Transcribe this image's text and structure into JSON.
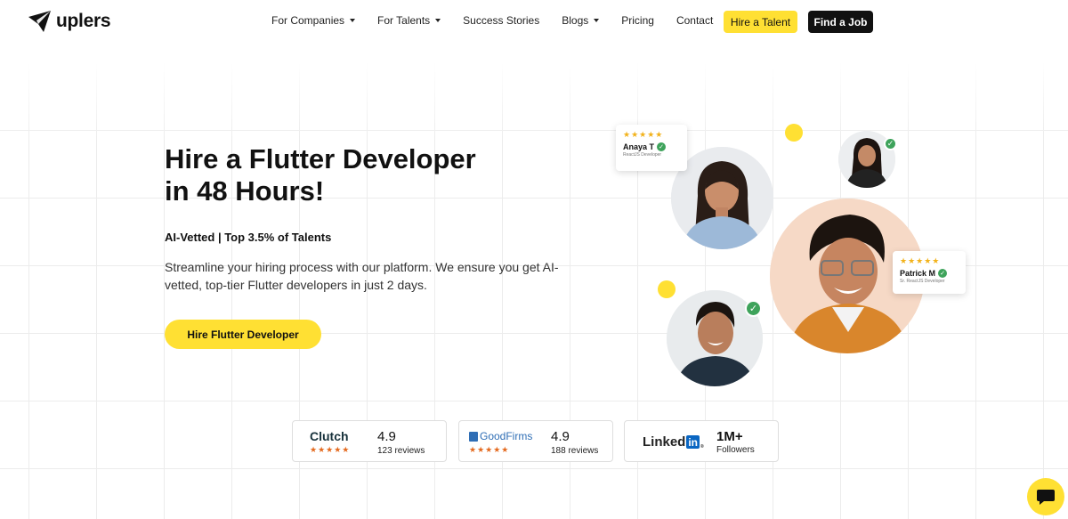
{
  "brand": {
    "name": "uplers"
  },
  "nav": {
    "items": [
      {
        "label": "For Companies",
        "has_dropdown": true
      },
      {
        "label": "For Talents",
        "has_dropdown": true
      },
      {
        "label": "Success Stories",
        "has_dropdown": false
      },
      {
        "label": "Blogs",
        "has_dropdown": true
      },
      {
        "label": "Pricing",
        "has_dropdown": false
      },
      {
        "label": "Contact",
        "has_dropdown": false
      }
    ],
    "hire_talent_label": "Hire a Talent",
    "find_job_label": "Find a Job"
  },
  "hero": {
    "title_line1": "Hire a Flutter Developer",
    "title_line2": "in 48 Hours!",
    "tagline": "AI-Vetted | Top 3.5% of Talents",
    "description": "Streamline your hiring process with our platform. We ensure you get AI-vetted, top-tier Flutter developers in just 2 days.",
    "cta_label": "Hire Flutter Developer"
  },
  "profiles": {
    "anaya": {
      "stars": "★★★★★",
      "name": "Anaya T",
      "role": "ReactJS Developer"
    },
    "patrick": {
      "stars": "★★★★★",
      "name": "Patrick M",
      "role": "Sr. ReactJS Developer"
    }
  },
  "reviews": {
    "clutch": {
      "brand": "Clutch",
      "stars": "★★★★★",
      "score": "4.9",
      "count": "123 reviews"
    },
    "goodfirms": {
      "brand": "GoodFirms",
      "stars": "★★★★★",
      "score": "4.9",
      "count": "188 reviews"
    },
    "linkedin": {
      "brand_text": "Linked",
      "brand_in": "in",
      "reg": "®",
      "score": "1M+",
      "count": "Followers"
    }
  },
  "colors": {
    "accent_yellow": "#ffe033",
    "dark": "#111111",
    "verified_green": "#3ea35b",
    "star_gold": "#f2b21a",
    "star_orange": "#e46a1f",
    "linkedin_blue": "#0a66c2",
    "goodfirms_blue": "#2f6eb5"
  }
}
